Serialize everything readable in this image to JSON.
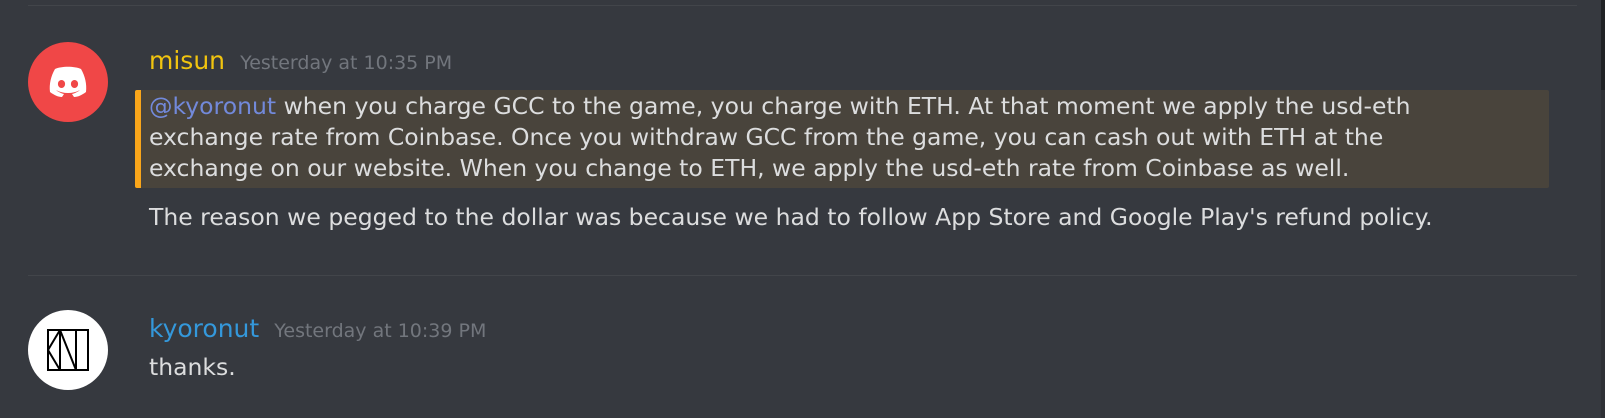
{
  "messages": [
    {
      "author": "misun",
      "timestamp": "Yesterday at 10:35 PM",
      "avatar_icon": "discord-logo-icon",
      "mention": "@kyoronut",
      "lines": [
        " when you charge GCC to the game, you charge with ETH. At that moment we apply the usd-eth",
        "exchange rate from Coinbase. Once you withdraw GCC from the game, you can cash out with ETH at the",
        "exchange on our website. When you change to ETH, we apply the usd-eth rate from Coinbase as well.",
        "The reason we pegged to the dollar was because we had to follow App Store and Google Play's refund policy."
      ]
    },
    {
      "author": "kyoronut",
      "timestamp": "Yesterday at 10:39 PM",
      "avatar_icon": "kyoronut-logo-icon",
      "lines": [
        "thanks."
      ]
    }
  ],
  "colors": {
    "background": "#36393f",
    "mention_highlight": "#49443c",
    "mention_bar": "#faa61a",
    "misun_name": "#f1c40f",
    "kyoronut_name": "#3498db",
    "mention_text": "#7289da"
  }
}
